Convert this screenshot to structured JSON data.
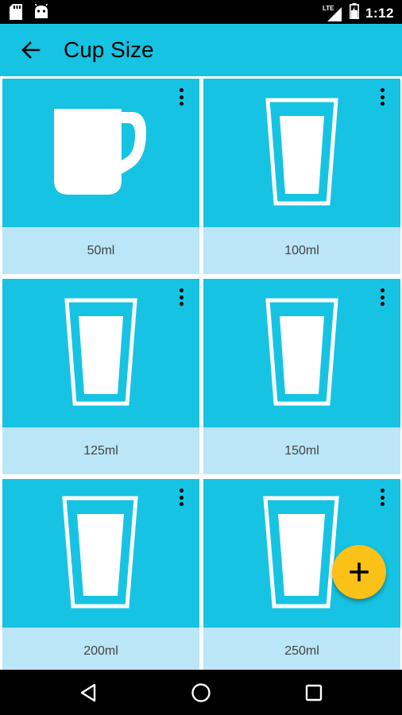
{
  "status_bar": {
    "time": "1:12",
    "network": "LTE",
    "icons": [
      "sd-card-icon",
      "android-icon",
      "lte-signal-icon",
      "battery-icon"
    ]
  },
  "app_bar": {
    "title": "Cup Size",
    "back_icon": "arrow-back-icon"
  },
  "cups": [
    {
      "label": "50ml",
      "icon": "mug-icon"
    },
    {
      "label": "100ml",
      "icon": "glass-icon"
    },
    {
      "label": "125ml",
      "icon": "glass-icon"
    },
    {
      "label": "150ml",
      "icon": "glass-icon"
    },
    {
      "label": "200ml",
      "icon": "glass-icon"
    },
    {
      "label": "250ml",
      "icon": "glass-icon"
    }
  ],
  "fab": {
    "icon": "plus-icon"
  },
  "nav_bar": {
    "icons": [
      "back-triangle-icon",
      "home-circle-icon",
      "recents-square-icon"
    ]
  },
  "colors": {
    "primary": "#17c3e2",
    "label_background": "#bae6f7",
    "fab": "#fcc117"
  }
}
